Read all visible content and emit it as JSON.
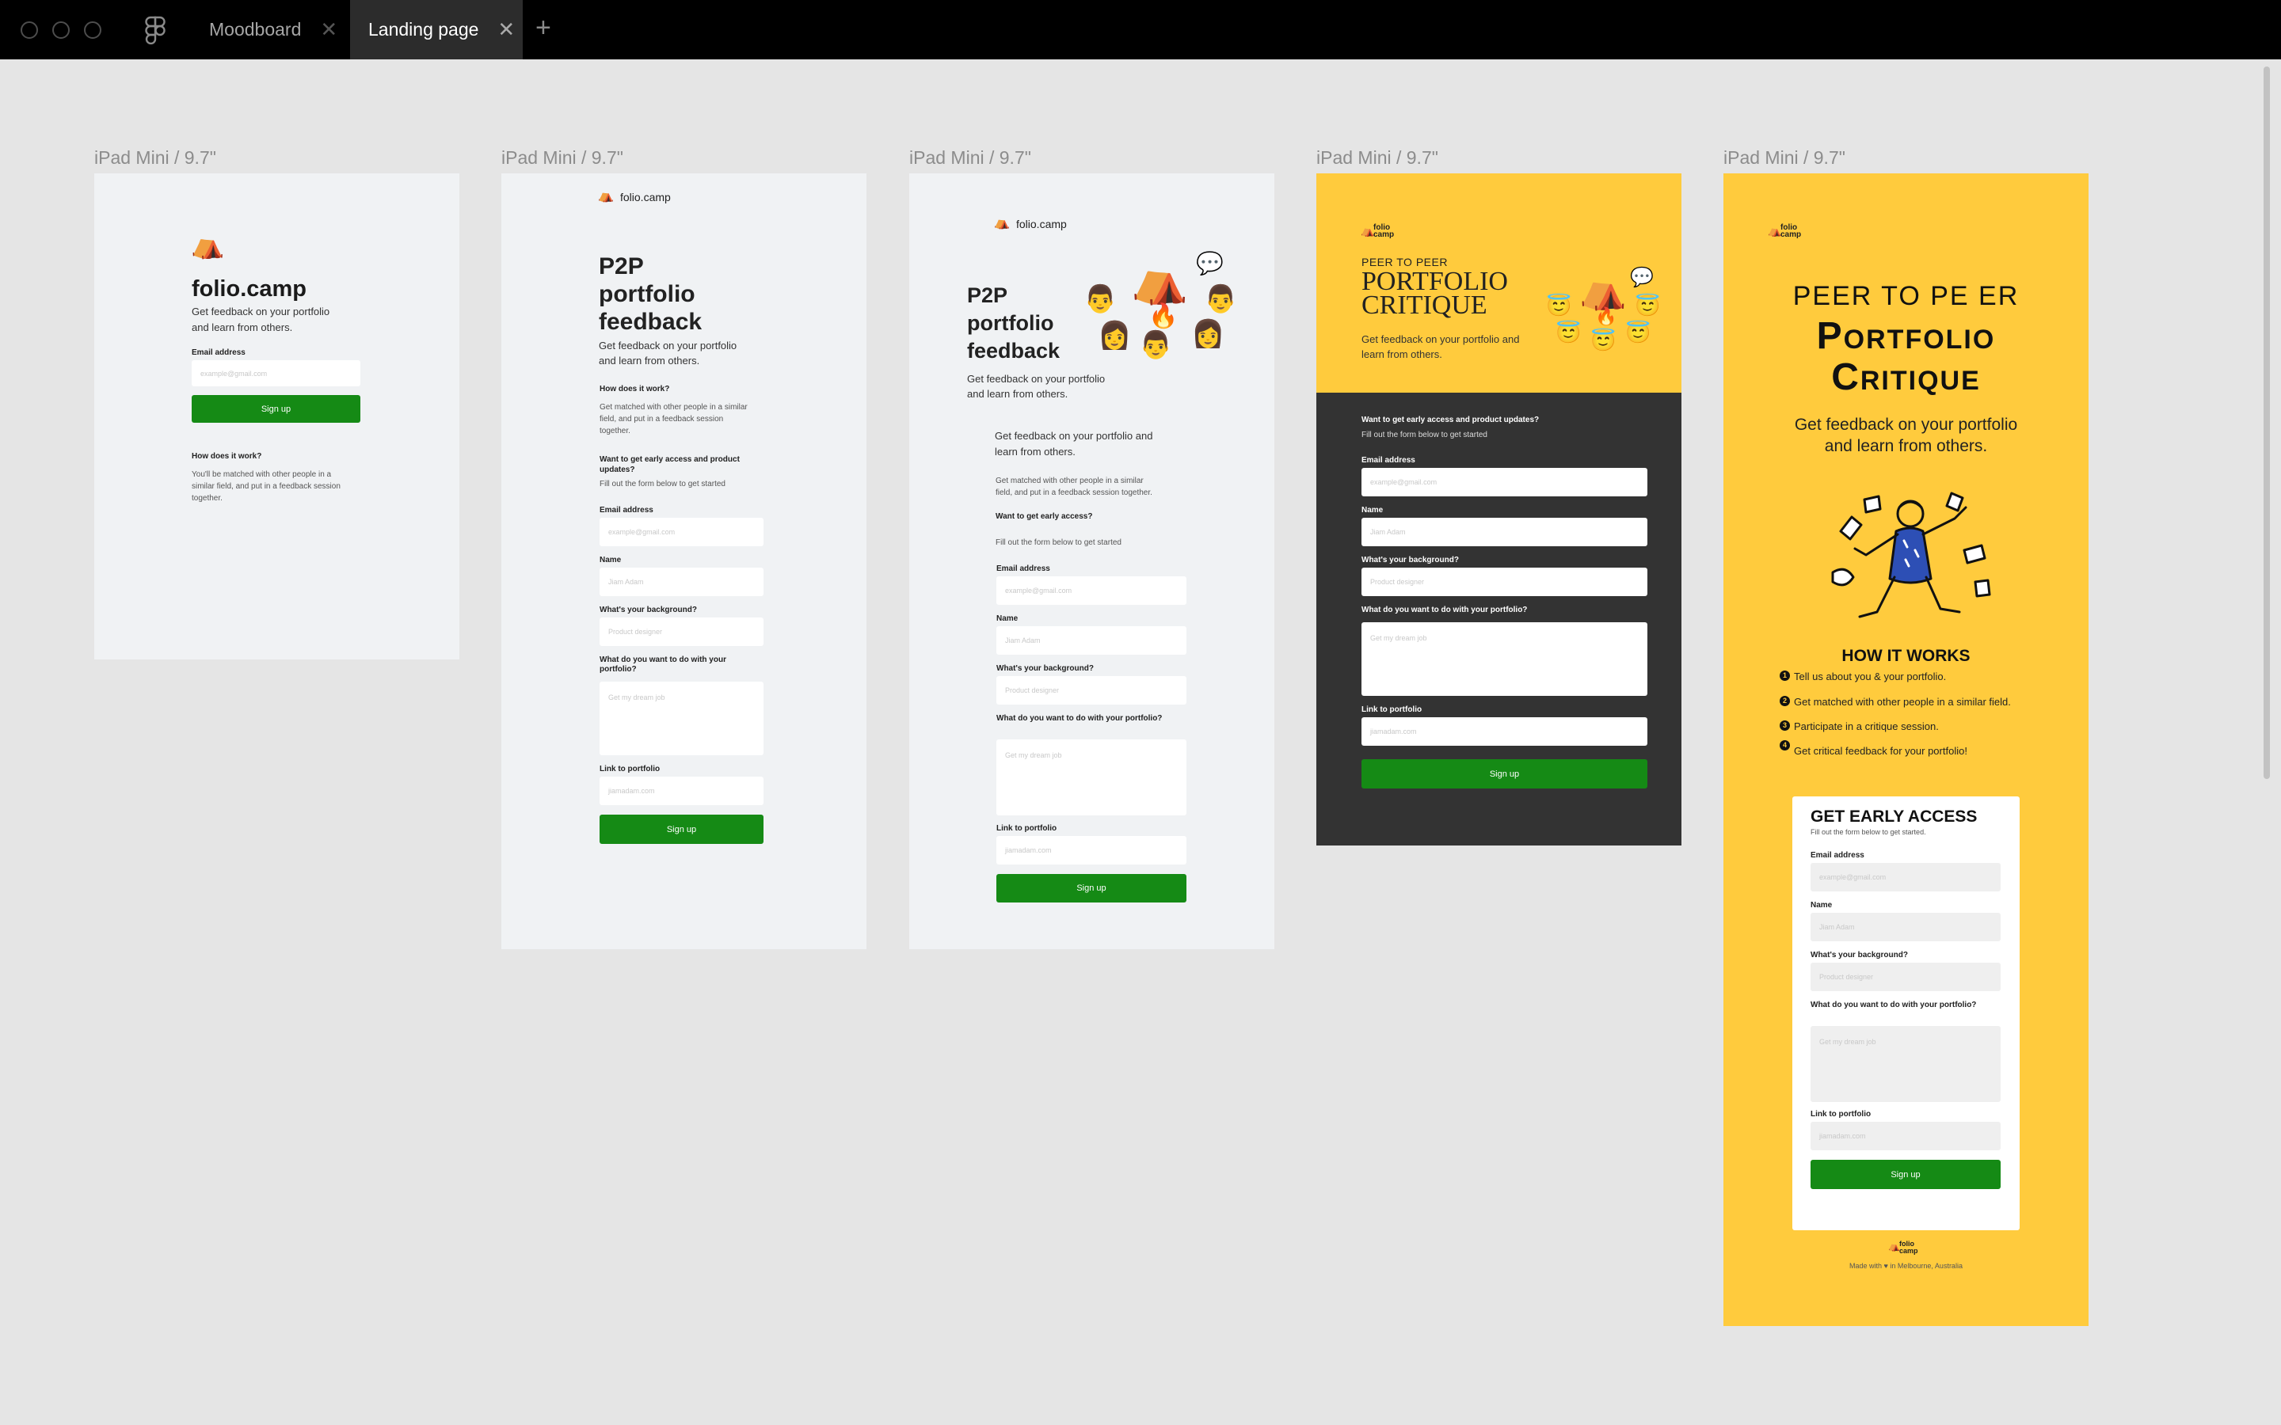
{
  "app": {
    "tabs": [
      {
        "label": "Moodboard",
        "close": "✕"
      },
      {
        "label": "Landing page",
        "close": "✕"
      }
    ],
    "add_tab": "+"
  },
  "frame_label": "iPad Mini / 9.7\"",
  "common": {
    "logo_text": "folio.camp",
    "logo_stacked_1": "folio",
    "logo_stacked_2": "camp",
    "tent_emoji": "⛺",
    "fire_emoji": "🔥",
    "speech_emoji": "💬",
    "man_emoji": "👨",
    "woman_emoji": "👩",
    "angel_emoji": "😇",
    "p2p_1": "P2P",
    "p2p_2": "portfolio",
    "p2p_3": "feedback",
    "tagline_1": "Get feedback on your portfolio",
    "tagline_2": "and learn from others.",
    "email_label": "Email address",
    "email_placeholder": "example@gmail.com",
    "name_label": "Name",
    "name_placeholder": "Jiam Adam",
    "bg_label": "What's your background?",
    "bg_placeholder": "Product designer",
    "goal_label": "What do you want to do with your portfolio?",
    "goal_label_a": "What do you want to do with your",
    "goal_label_b": "portfolio?",
    "goal_placeholder": "Get my dream job",
    "link_label": "Link to portfolio",
    "link_placeholder": "jiamadam.com",
    "signup": "Sign up",
    "how_q": "How does it work?",
    "fill_form": "Fill out the form below to get started"
  },
  "frame1": {
    "how_1": "You'll be matched with other people in a",
    "how_2": "similar field, and put in a feedback session",
    "how_3": "together."
  },
  "frame2": {
    "how_1": "Get matched with other people in a similar",
    "how_2": "field, and put in a feedback session",
    "how_3": "together.",
    "early_1": "Want to get early access and product",
    "early_2": "updates?"
  },
  "frame3": {
    "intro_1": "Get feedback on your portfolio and",
    "intro_2": "learn from others.",
    "match_1": "Get matched with other people in a similar",
    "match_2": "field, and put in a feedback session together.",
    "early": "Want to get early access?"
  },
  "frame4": {
    "kicker": "PEER TO PEER",
    "title_1": "PORTFOLIO",
    "title_2": "CRITIQUE",
    "tag_1": "Get feedback on your portfolio and",
    "tag_2": "learn from others.",
    "early": "Want to get early access and product updates?"
  },
  "frame5": {
    "kicker": "PEER TO PE ER",
    "title_1": "Portfolio",
    "title_2": "Critique",
    "tag_1": "Get feedback on your portfolio",
    "tag_2": "and learn from others.",
    "how_title": "HOW IT WORKS",
    "steps": [
      {
        "num": "1",
        "text": "Tell us about you & your portfolio."
      },
      {
        "num": "2",
        "text": "Get matched with other people in a similar field."
      },
      {
        "num": "3",
        "text": "Participate in a critique session."
      },
      {
        "num": "4",
        "text": "Get critical feedback for your portfolio!"
      }
    ],
    "early_title": "GET EARLY ACCESS",
    "early_sub": "Fill out the form below to get started.",
    "footer": "Made with ♥ in Melbourne, Australia"
  },
  "colors": {
    "canvas": "#e5e5e5",
    "frame_grey": "#f0f2f4",
    "yellow": "#ffcb3d",
    "dark": "#333333",
    "green": "#158a15"
  }
}
